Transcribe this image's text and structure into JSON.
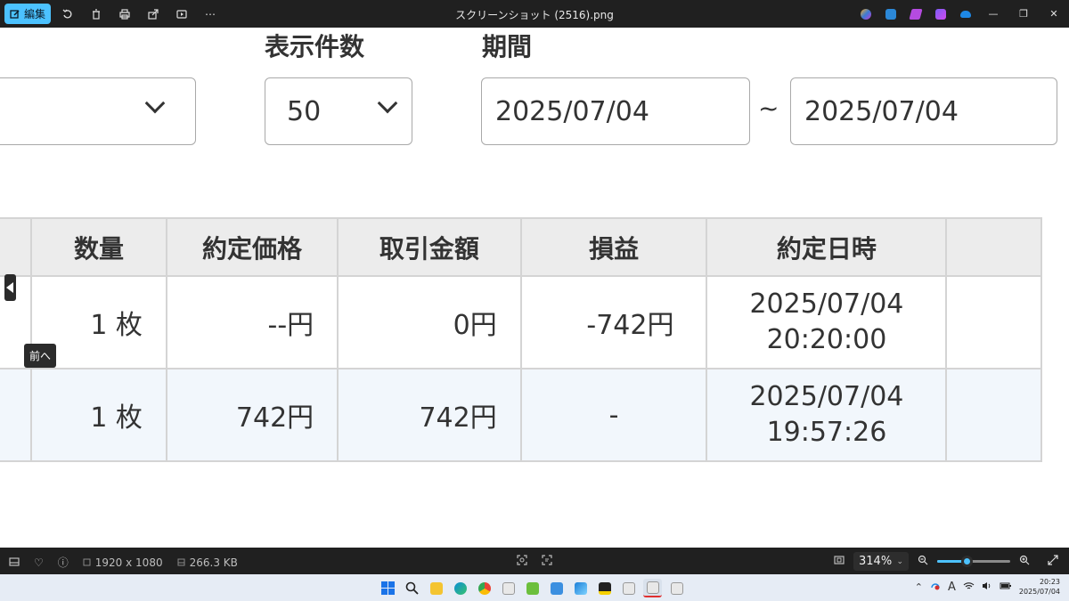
{
  "titlebar": {
    "edit_label": "編集",
    "file_title": "スクリーンショット (2516).png",
    "minimize": "—",
    "restore": "❐",
    "close": "✕"
  },
  "filters": {
    "display_count_label": "表示件数",
    "display_count_value": "50",
    "period_label": "期間",
    "period_from": "2025/07/04",
    "period_to": "2025/07/04",
    "range_separator": "~"
  },
  "table": {
    "headers": [
      "数量",
      "約定価格",
      "取引金額",
      "損益",
      "約定日時"
    ],
    "rows": [
      {
        "quantity": "1 枚",
        "price": "--円",
        "amount": "0円",
        "pnl": "-742円",
        "date": "2025/07/04",
        "time": "20:20:00"
      },
      {
        "quantity": "1 枚",
        "price": "742円",
        "amount": "742円",
        "pnl": "-",
        "date": "2025/07/04",
        "time": "19:57:26"
      }
    ]
  },
  "tooltip": {
    "prev": "前へ"
  },
  "statusbar": {
    "resolution": "1920 x 1080",
    "file_size": "266.3 KB",
    "zoom_level": "314%",
    "zoom_slider_fraction": 0.4
  },
  "taskbar": {
    "clock_time": "20:23",
    "clock_date": "2025/07/04",
    "ime": "A"
  },
  "colors": {
    "accent": "#4cc2ff",
    "header_bg": "#ececec",
    "alt_row_bg": "#f2f7fc",
    "chrome_bg": "#202020"
  }
}
